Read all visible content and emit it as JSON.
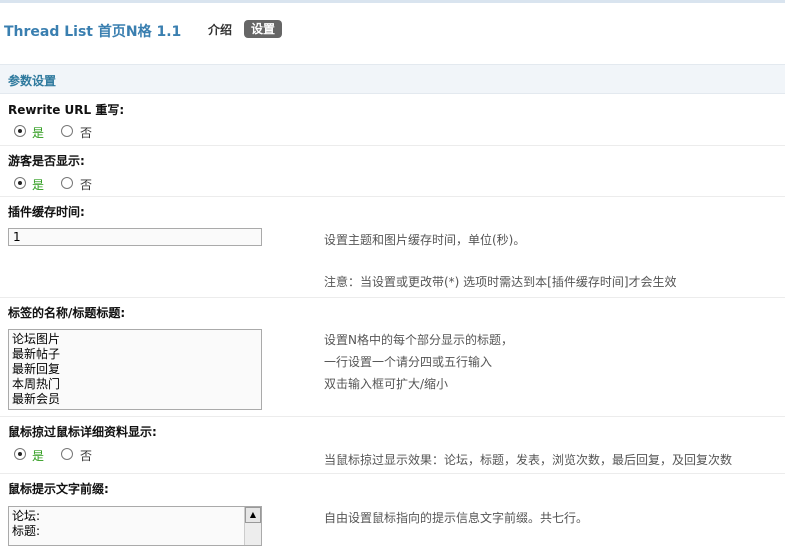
{
  "header": {
    "title": "Thread List 首页N格 1.1",
    "tab_intro": "介绍",
    "tab_settings": "设置"
  },
  "section": {
    "title": "参数设置"
  },
  "settings": {
    "rewrite": {
      "label": "Rewrite URL 重写:",
      "yes": "是",
      "no": "否"
    },
    "guest": {
      "label": "游客是否显示:",
      "yes": "是",
      "no": "否"
    },
    "cache": {
      "label": "插件缓存时间:",
      "value": "1",
      "hint1": "设置主题和图片缓存时间，单位(秒)。",
      "hint2": "注意：当设置或更改带(*) 选项时需达到本[插件缓存时间]才会生效"
    },
    "tabs": {
      "label": "标签的名称/标题标题:",
      "lines": [
        "论坛图片",
        "最新帖子",
        "最新回复",
        "本周热门",
        "最新会员"
      ],
      "hint1": "设置N格中的每个部分显示的标题，",
      "hint2": "一行设置一个请分四或五行输入",
      "hint3": "双击输入框可扩大/缩小"
    },
    "hover": {
      "label": "鼠标掠过鼠标详细资料显示:",
      "yes": "是",
      "no": "否",
      "hint": "当鼠标掠过显示效果：论坛，标题，发表，浏览次数，最后回复，及回复次数"
    },
    "prefix": {
      "label": "鼠标提示文字前缀:",
      "lines": [
        "论坛:",
        "标题:"
      ],
      "hint1": "自由设置鼠标指向的提示信息文字前缀。共七行。"
    }
  }
}
